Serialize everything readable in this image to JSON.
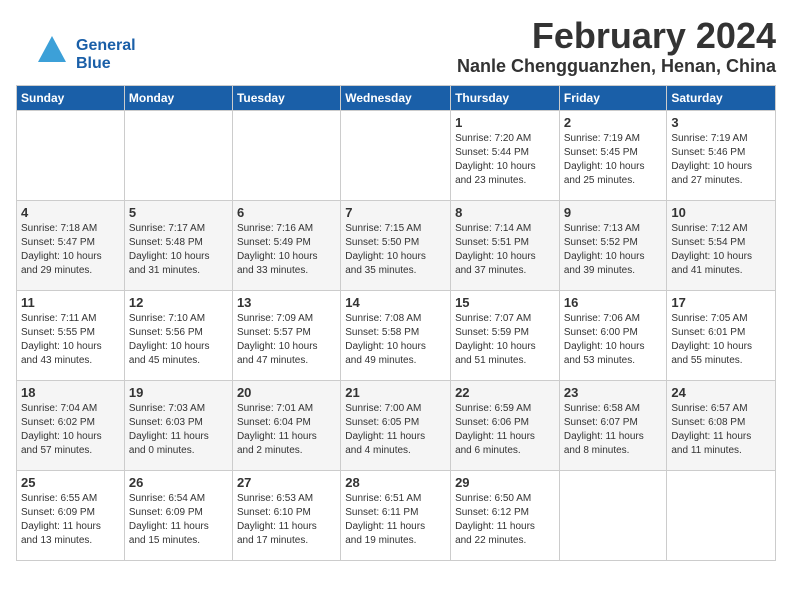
{
  "app": {
    "logo_line1": "General",
    "logo_line2": "Blue"
  },
  "header": {
    "month": "February 2024",
    "location": "Nanle Chengguanzhen, Henan, China"
  },
  "weekdays": [
    "Sunday",
    "Monday",
    "Tuesday",
    "Wednesday",
    "Thursday",
    "Friday",
    "Saturday"
  ],
  "weeks": [
    [
      {
        "day": "",
        "info": ""
      },
      {
        "day": "",
        "info": ""
      },
      {
        "day": "",
        "info": ""
      },
      {
        "day": "",
        "info": ""
      },
      {
        "day": "1",
        "info": "Sunrise: 7:20 AM\nSunset: 5:44 PM\nDaylight: 10 hours\nand 23 minutes."
      },
      {
        "day": "2",
        "info": "Sunrise: 7:19 AM\nSunset: 5:45 PM\nDaylight: 10 hours\nand 25 minutes."
      },
      {
        "day": "3",
        "info": "Sunrise: 7:19 AM\nSunset: 5:46 PM\nDaylight: 10 hours\nand 27 minutes."
      }
    ],
    [
      {
        "day": "4",
        "info": "Sunrise: 7:18 AM\nSunset: 5:47 PM\nDaylight: 10 hours\nand 29 minutes."
      },
      {
        "day": "5",
        "info": "Sunrise: 7:17 AM\nSunset: 5:48 PM\nDaylight: 10 hours\nand 31 minutes."
      },
      {
        "day": "6",
        "info": "Sunrise: 7:16 AM\nSunset: 5:49 PM\nDaylight: 10 hours\nand 33 minutes."
      },
      {
        "day": "7",
        "info": "Sunrise: 7:15 AM\nSunset: 5:50 PM\nDaylight: 10 hours\nand 35 minutes."
      },
      {
        "day": "8",
        "info": "Sunrise: 7:14 AM\nSunset: 5:51 PM\nDaylight: 10 hours\nand 37 minutes."
      },
      {
        "day": "9",
        "info": "Sunrise: 7:13 AM\nSunset: 5:52 PM\nDaylight: 10 hours\nand 39 minutes."
      },
      {
        "day": "10",
        "info": "Sunrise: 7:12 AM\nSunset: 5:54 PM\nDaylight: 10 hours\nand 41 minutes."
      }
    ],
    [
      {
        "day": "11",
        "info": "Sunrise: 7:11 AM\nSunset: 5:55 PM\nDaylight: 10 hours\nand 43 minutes."
      },
      {
        "day": "12",
        "info": "Sunrise: 7:10 AM\nSunset: 5:56 PM\nDaylight: 10 hours\nand 45 minutes."
      },
      {
        "day": "13",
        "info": "Sunrise: 7:09 AM\nSunset: 5:57 PM\nDaylight: 10 hours\nand 47 minutes."
      },
      {
        "day": "14",
        "info": "Sunrise: 7:08 AM\nSunset: 5:58 PM\nDaylight: 10 hours\nand 49 minutes."
      },
      {
        "day": "15",
        "info": "Sunrise: 7:07 AM\nSunset: 5:59 PM\nDaylight: 10 hours\nand 51 minutes."
      },
      {
        "day": "16",
        "info": "Sunrise: 7:06 AM\nSunset: 6:00 PM\nDaylight: 10 hours\nand 53 minutes."
      },
      {
        "day": "17",
        "info": "Sunrise: 7:05 AM\nSunset: 6:01 PM\nDaylight: 10 hours\nand 55 minutes."
      }
    ],
    [
      {
        "day": "18",
        "info": "Sunrise: 7:04 AM\nSunset: 6:02 PM\nDaylight: 10 hours\nand 57 minutes."
      },
      {
        "day": "19",
        "info": "Sunrise: 7:03 AM\nSunset: 6:03 PM\nDaylight: 11 hours\nand 0 minutes."
      },
      {
        "day": "20",
        "info": "Sunrise: 7:01 AM\nSunset: 6:04 PM\nDaylight: 11 hours\nand 2 minutes."
      },
      {
        "day": "21",
        "info": "Sunrise: 7:00 AM\nSunset: 6:05 PM\nDaylight: 11 hours\nand 4 minutes."
      },
      {
        "day": "22",
        "info": "Sunrise: 6:59 AM\nSunset: 6:06 PM\nDaylight: 11 hours\nand 6 minutes."
      },
      {
        "day": "23",
        "info": "Sunrise: 6:58 AM\nSunset: 6:07 PM\nDaylight: 11 hours\nand 8 minutes."
      },
      {
        "day": "24",
        "info": "Sunrise: 6:57 AM\nSunset: 6:08 PM\nDaylight: 11 hours\nand 11 minutes."
      }
    ],
    [
      {
        "day": "25",
        "info": "Sunrise: 6:55 AM\nSunset: 6:09 PM\nDaylight: 11 hours\nand 13 minutes."
      },
      {
        "day": "26",
        "info": "Sunrise: 6:54 AM\nSunset: 6:09 PM\nDaylight: 11 hours\nand 15 minutes."
      },
      {
        "day": "27",
        "info": "Sunrise: 6:53 AM\nSunset: 6:10 PM\nDaylight: 11 hours\nand 17 minutes."
      },
      {
        "day": "28",
        "info": "Sunrise: 6:51 AM\nSunset: 6:11 PM\nDaylight: 11 hours\nand 19 minutes."
      },
      {
        "day": "29",
        "info": "Sunrise: 6:50 AM\nSunset: 6:12 PM\nDaylight: 11 hours\nand 22 minutes."
      },
      {
        "day": "",
        "info": ""
      },
      {
        "day": "",
        "info": ""
      }
    ]
  ]
}
